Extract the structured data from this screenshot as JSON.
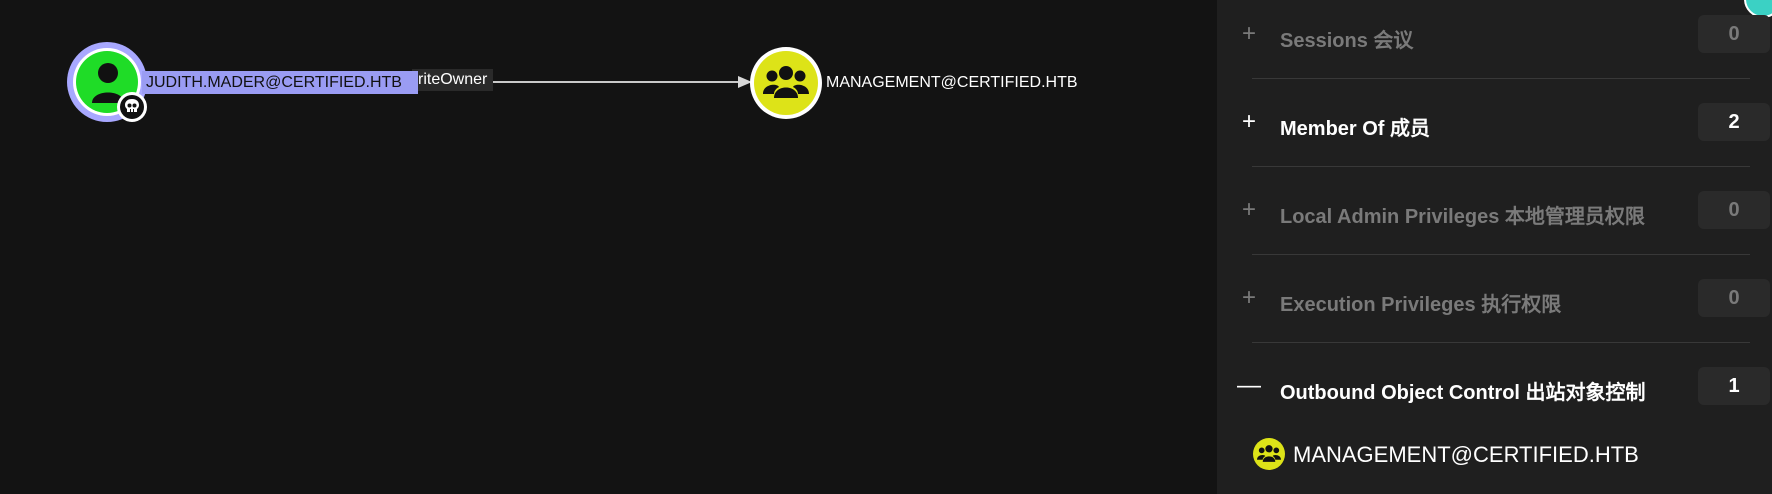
{
  "graph": {
    "source_node": {
      "label": "JUDITH.MADER@CERTIFIED.HTB",
      "type_icon": "user-icon",
      "badge_icon": "skull-icon",
      "fill_color": "#1fdc27",
      "ring_color": "#a8a8ff"
    },
    "edge": {
      "label": "riteOwner"
    },
    "target_node": {
      "label": "MANAGEMENT@CERTIFIED.HTB",
      "type_icon": "group-icon",
      "fill_color": "#dde318"
    }
  },
  "panel": {
    "sections": [
      {
        "label": "Sessions  会议",
        "count": "0",
        "toggle": "+",
        "state": "dim"
      },
      {
        "label": "Member Of  成员",
        "count": "2",
        "toggle": "+",
        "state": "active"
      },
      {
        "label": "Local Admin Privileges  本地管理员权限",
        "count": "0",
        "toggle": "+",
        "state": "dim"
      },
      {
        "label": "Execution Privileges  执行权限",
        "count": "0",
        "toggle": "+",
        "state": "dim"
      },
      {
        "label": "Outbound Object Control  出站对象控制",
        "count": "1",
        "toggle": "—",
        "state": "active"
      }
    ],
    "outbound_items": [
      {
        "name": "MANAGEMENT@CERTIFIED.HTB",
        "icon": "group-icon"
      }
    ]
  }
}
